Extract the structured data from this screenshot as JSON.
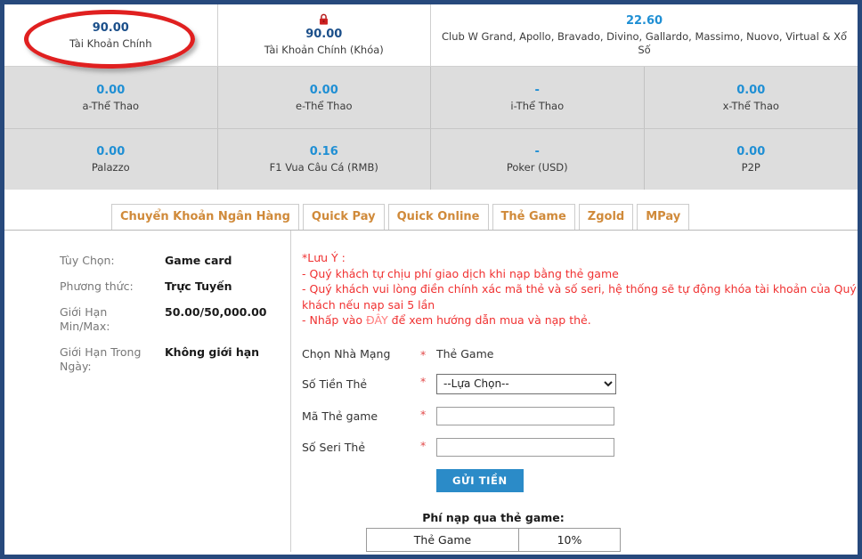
{
  "balances": {
    "top_row": [
      {
        "amount": "90.00",
        "label": "Tài Khoản Chính",
        "icon": null,
        "highlighted": true,
        "width": "25%",
        "color": "#1b4f8a"
      },
      {
        "amount": "90.00",
        "label": "Tài Khoản Chính (Khóa)",
        "icon": "lock-icon",
        "highlighted": false,
        "width": "25%",
        "color": "#1b4f8a"
      },
      {
        "amount": "22.60",
        "label": "Club W Grand, Apollo, Bravado, Divino, Gallardo, Massimo, Nuovo, Virtual & Xổ Số",
        "icon": null,
        "highlighted": false,
        "width": "50%",
        "color": "#1f8fd4"
      }
    ],
    "sub_rows": [
      [
        {
          "amount": "0.00",
          "label": "a-Thể Thao"
        },
        {
          "amount": "0.00",
          "label": "e-Thể Thao"
        },
        {
          "amount": "-",
          "label": "i-Thể Thao"
        },
        {
          "amount": "0.00",
          "label": "x-Thể Thao"
        }
      ],
      [
        {
          "amount": "0.00",
          "label": "Palazzo"
        },
        {
          "amount": "0.16",
          "label": "F1 Vua Câu Cá (RMB)"
        },
        {
          "amount": "-",
          "label": "Poker (USD)"
        },
        {
          "amount": "0.00",
          "label": "P2P"
        }
      ]
    ]
  },
  "tabs": [
    {
      "label": "Chuyển Khoản Ngân Hàng",
      "active": false
    },
    {
      "label": "Quick Pay",
      "active": false
    },
    {
      "label": "Quick Online",
      "active": false
    },
    {
      "label": "Thẻ Game",
      "active": true
    },
    {
      "label": "Zgold",
      "active": false
    },
    {
      "label": "MPay",
      "active": false
    }
  ],
  "info": {
    "rows": [
      {
        "key": "Tùy Chọn:",
        "value": "Game card"
      },
      {
        "key": "Phương thức:",
        "value": "Trực Tuyến"
      },
      {
        "key": "Giới Hạn Min/Max:",
        "value": "50.00/50,000.00"
      },
      {
        "key": "Giới Hạn Trong Ngày:",
        "value": "Không giới hạn"
      }
    ]
  },
  "notice": {
    "title": "*Lưu Ý :",
    "line1": "- Quý khách tự chịu phí giao dịch khi nạp bằng thẻ game",
    "line2": "- Quý khách vui lòng điền chính xác mã thẻ và số seri, hệ thống sẽ tự động khóa tài khoản của Quý khách nếu nạp sai 5 lần",
    "line3_before": "- Nhấp vào ",
    "line3_link": "ĐÂY",
    "line3_after": " để xem hướng dẫn mua và nạp thẻ."
  },
  "form": {
    "required_mark": "*",
    "provider": {
      "label": "Chọn Nhà Mạng",
      "value": "Thẻ Game"
    },
    "amount": {
      "label": "Số Tiền Thẻ",
      "selected": "--Lựa Chọn--"
    },
    "card_code": {
      "label": "Mã Thẻ game",
      "value": "",
      "placeholder": ""
    },
    "card_serial": {
      "label": "Số Seri Thẻ",
      "value": "",
      "placeholder": ""
    },
    "submit_label": "GỬI TIỀN"
  },
  "fee": {
    "title": "Phí nạp qua thẻ game:",
    "rows": [
      {
        "name": "Thẻ Game",
        "rate": "10%"
      }
    ]
  },
  "colors": {
    "page_border": "#27497c",
    "navy_amount": "#1b4f8a",
    "blue_amount": "#1f8fd4",
    "tab_text": "#d08a3a",
    "notice_red": "#f03232",
    "submit_blue": "#2b8bc8",
    "annotation_red": "#e02020",
    "sub_row_bg": "#dddddd"
  }
}
